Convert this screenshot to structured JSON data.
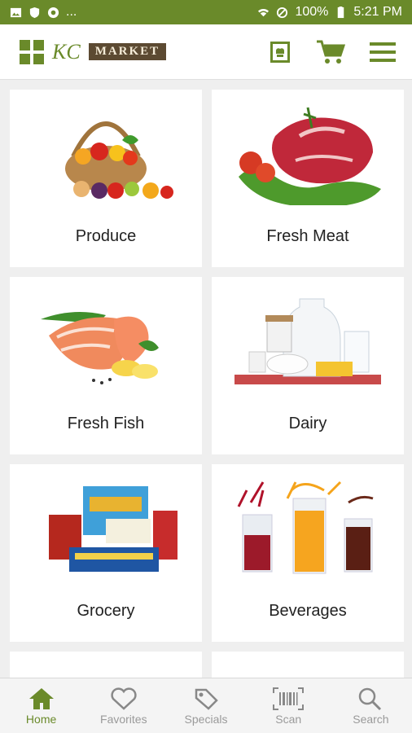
{
  "status_bar": {
    "battery": "100%",
    "time": "5:21 PM",
    "dots": "..."
  },
  "header": {
    "logo_script": "KC",
    "logo_word": "MARKET",
    "brand_color": "#6a8a2a"
  },
  "categories": [
    {
      "label": "Produce"
    },
    {
      "label": "Fresh Meat"
    },
    {
      "label": "Fresh Fish"
    },
    {
      "label": "Dairy"
    },
    {
      "label": "Grocery"
    },
    {
      "label": "Beverages"
    }
  ],
  "bottom_nav": [
    {
      "label": "Home",
      "icon": "home-icon",
      "active": true
    },
    {
      "label": "Favorites",
      "icon": "heart-icon"
    },
    {
      "label": "Specials",
      "icon": "tag-icon"
    },
    {
      "label": "Scan",
      "icon": "barcode-icon"
    },
    {
      "label": "Search",
      "icon": "search-icon"
    }
  ]
}
